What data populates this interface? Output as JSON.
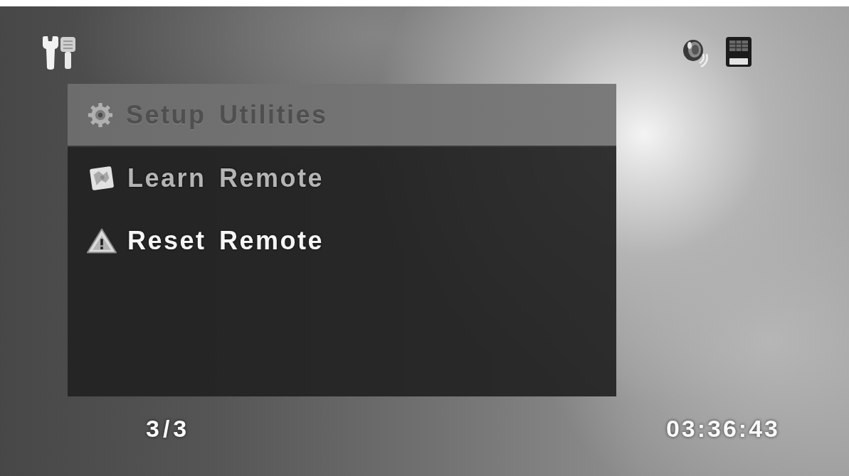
{
  "menu": {
    "title": "Setup Utilities",
    "items": [
      {
        "label": "Learn Remote",
        "selected": false
      },
      {
        "label": "Reset Remote",
        "selected": true
      }
    ]
  },
  "footer": {
    "page_indicator": "3/3",
    "clock": "03:36:43"
  }
}
